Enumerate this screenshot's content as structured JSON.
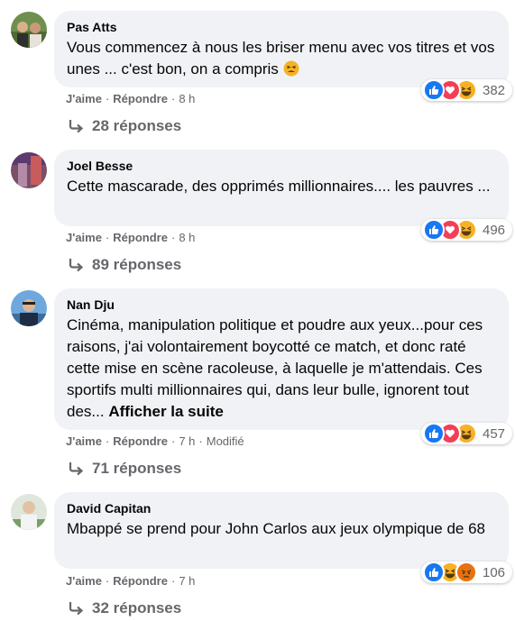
{
  "comments": [
    {
      "author": "Pas Atts",
      "text": "Vous commencez à nous les briser menu avec vos titres et vos unes ... c'est bon, on a compris",
      "emoji": "tired-face-emoji",
      "like": "J'aime",
      "reply": "Répondre",
      "time": "8 h",
      "reaction_count": "382",
      "reactions": [
        "like",
        "love",
        "haha"
      ],
      "replies": "28 réponses"
    },
    {
      "author": "Joel Besse",
      "text": "Cette mascarade, des opprimés millionnaires.... les pauvres ...",
      "like": "J'aime",
      "reply": "Répondre",
      "time": "8 h",
      "reaction_count": "496",
      "reactions": [
        "like",
        "love",
        "haha"
      ],
      "replies": "89 réponses"
    },
    {
      "author": "Nan Dju",
      "text": "Cinéma, manipulation politique et poudre aux yeux...pour ces raisons, j'ai volontairement boycotté ce match, et donc raté cette mise en scène racoleuse, à laquelle je m'attendais. Ces sportifs multi millionnaires qui, dans leur bulle, ignorent tout des...",
      "see_more": "Afficher la suite",
      "like": "J'aime",
      "reply": "Répondre",
      "time": "7 h",
      "modified": "Modifié",
      "reaction_count": "457",
      "reactions": [
        "like",
        "love",
        "haha"
      ],
      "replies": "71 réponses"
    },
    {
      "author": "David Capitan",
      "text": "Mbappé se prend pour John Carlos aux jeux olympique de 68",
      "like": "J'aime",
      "reply": "Répondre",
      "time": "7 h",
      "reaction_count": "106",
      "reactions": [
        "like",
        "haha",
        "angry"
      ],
      "replies": "32 réponses"
    }
  ],
  "colors": {
    "bubble": "#f0f2f5",
    "secondary_text": "#65676b",
    "like_blue": "#1877f2",
    "love_red": "#f33e58",
    "haha_yellow": "#f7b125",
    "angry_orange": "#e9710f"
  }
}
